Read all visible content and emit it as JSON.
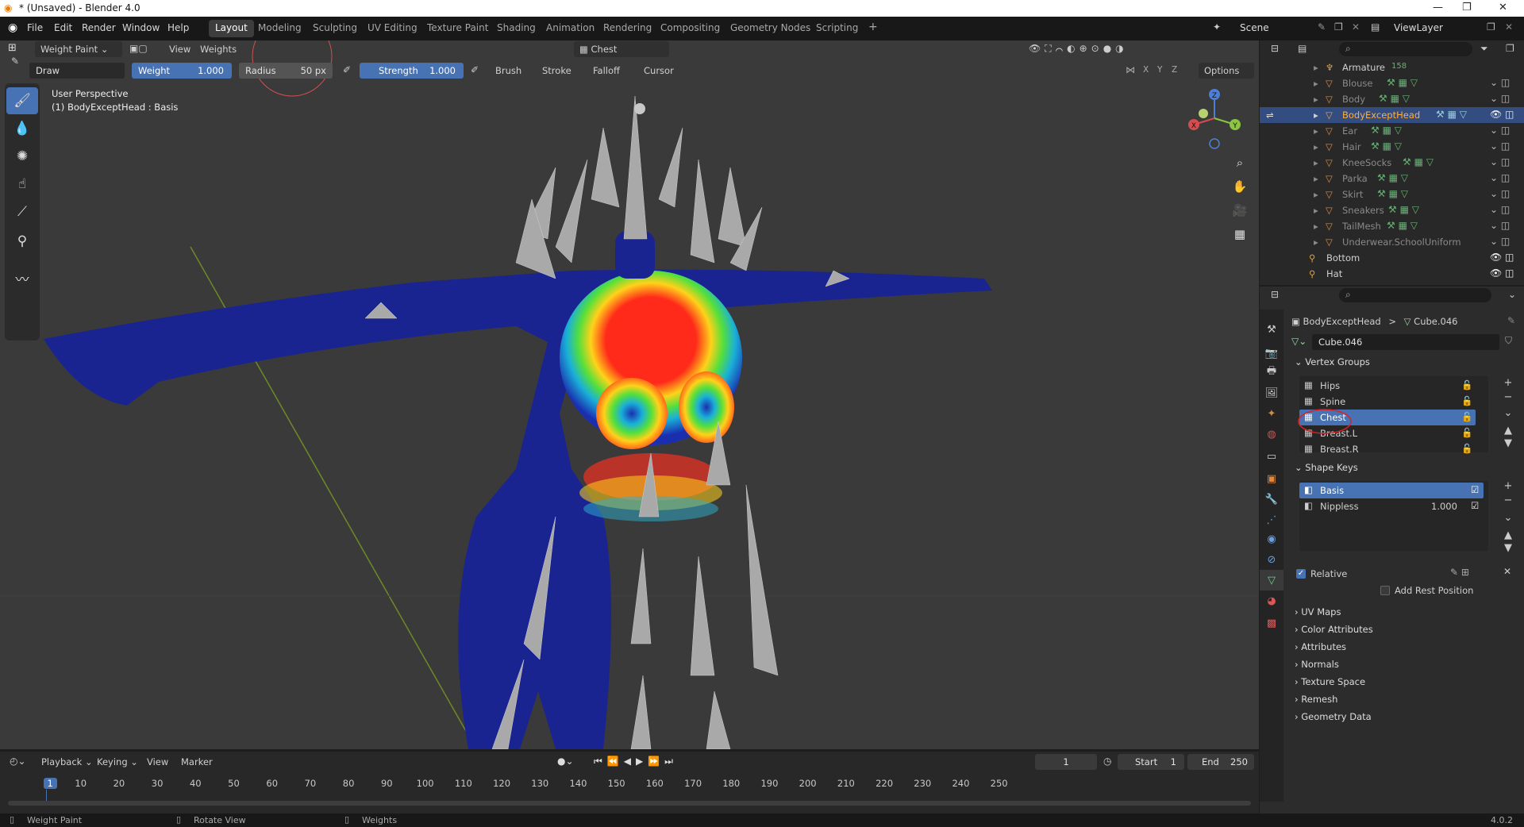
{
  "titlebar": {
    "title": "* (Unsaved) - Blender 4.0",
    "minimize": "—",
    "restore": "❐",
    "close": "✕"
  },
  "menu": [
    "File",
    "Edit",
    "Render",
    "Window",
    "Help"
  ],
  "workspaces": [
    "Layout",
    "Modeling",
    "Sculpting",
    "UV Editing",
    "Texture Paint",
    "Shading",
    "Animation",
    "Rendering",
    "Compositing",
    "Geometry Nodes",
    "Scripting"
  ],
  "workspace_add": "+",
  "scene": {
    "label": "Scene",
    "view_layer": "ViewLayer"
  },
  "viewport": {
    "mode": "Weight Paint",
    "view_menu": "View",
    "weights_menu": "Weights",
    "active_group_dropdown": "Chest",
    "brush_name": "Draw",
    "weight": {
      "label": "Weight",
      "value": "1.000"
    },
    "radius": {
      "label": "Radius",
      "value": "50 px"
    },
    "strength": {
      "label": "Strength",
      "value": "1.000"
    },
    "menus": [
      "Brush",
      "Stroke",
      "Falloff",
      "Cursor"
    ],
    "mirror_axes": [
      "X",
      "Y",
      "Z"
    ],
    "options": "Options",
    "info_line1": "User Perspective",
    "info_line2": "(1) BodyExceptHead : Basis",
    "gizmo": {
      "x": "X",
      "y": "Y",
      "z": "Z"
    }
  },
  "outliner": {
    "items": [
      {
        "name": "Armature",
        "badge": "158"
      },
      {
        "name": "Blouse"
      },
      {
        "name": "Body"
      },
      {
        "name": "BodyExceptHead",
        "selected": true
      },
      {
        "name": "Ear"
      },
      {
        "name": "Hair"
      },
      {
        "name": "KneeSocks"
      },
      {
        "name": "Parka"
      },
      {
        "name": "Skirt"
      },
      {
        "name": "Sneakers"
      },
      {
        "name": "TailMesh"
      },
      {
        "name": "Underwear.SchoolUniform"
      },
      {
        "name": "Bottom"
      },
      {
        "name": "Hat"
      }
    ]
  },
  "properties": {
    "breadcrumb_object": "BodyExceptHead",
    "breadcrumb_sep": ">",
    "breadcrumb_data": "Cube.046",
    "mesh_name": "Cube.046",
    "vertex_groups_title": "Vertex Groups",
    "vertex_groups": [
      "Hips",
      "Spine",
      "Chest",
      "Breast.L",
      "Breast.R"
    ],
    "selected_vertex_group": "Chest",
    "shape_keys_title": "Shape Keys",
    "shape_keys": [
      {
        "name": "Basis",
        "value": ""
      },
      {
        "name": "Nippless",
        "value": "1.000"
      }
    ],
    "relative_label": "Relative",
    "add_rest_position": "Add Rest Position",
    "collapsed_panels": [
      "UV Maps",
      "Color Attributes",
      "Attributes",
      "Normals",
      "Texture Space",
      "Remesh",
      "Geometry Data"
    ]
  },
  "timeline": {
    "menus": [
      "Playback",
      "Keying",
      "View",
      "Marker"
    ],
    "current_frame": "1",
    "start_label": "Start",
    "start": "1",
    "end_label": "End",
    "end": "250",
    "ticks": [
      "1",
      "10",
      "20",
      "30",
      "40",
      "50",
      "60",
      "70",
      "80",
      "90",
      "100",
      "110",
      "120",
      "130",
      "140",
      "150",
      "160",
      "170",
      "180",
      "190",
      "200",
      "210",
      "220",
      "230",
      "240",
      "250"
    ]
  },
  "status": {
    "left": "Weight Paint",
    "mid": "Rotate View",
    "right": "Weights",
    "version": "4.0.2"
  },
  "colors": {
    "accent": "#4772b3",
    "viewport_bg": "#3a3a3a",
    "header": "#303030"
  }
}
